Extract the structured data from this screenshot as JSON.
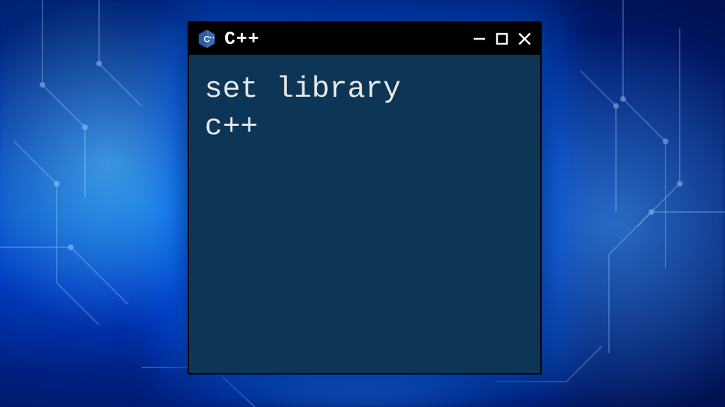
{
  "window": {
    "title": "C++",
    "icon_name": "cpp-logo-icon"
  },
  "content": {
    "line1": "set library",
    "line2": "c++"
  },
  "colors": {
    "window_bg": "#0d3556",
    "titlebar_bg": "#000000",
    "text": "#e8e8e8"
  }
}
